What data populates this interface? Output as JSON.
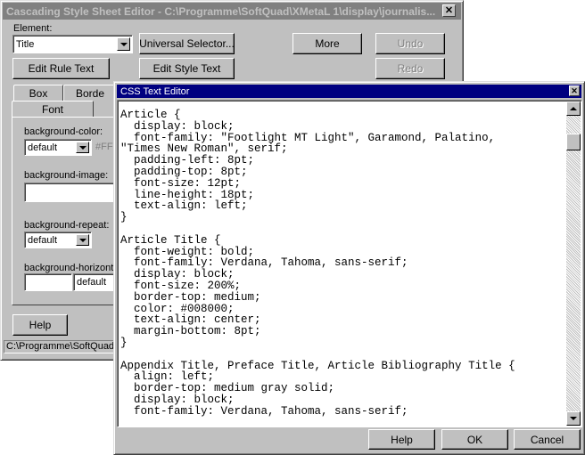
{
  "main_window": {
    "title": "Cascading Style Sheet Editor - C:\\Programme\\SoftQuad\\XMetaL 1\\display\\journalis...",
    "element_label": "Element:",
    "element_value": "Title",
    "buttons": {
      "universal_selector": "Universal Selector...",
      "more": "More",
      "undo": "Undo",
      "redo": "Redo",
      "edit_rule_text": "Edit Rule Text",
      "edit_style_text": "Edit Style Text",
      "help": "Help"
    },
    "tabs": [
      "Box",
      "Borde",
      "Font"
    ],
    "fields": {
      "background_color_label": "background-color:",
      "background_color_value": "default",
      "background_color_hex": "#FF",
      "background_image_label": "background-image:",
      "background_image_value": "",
      "background_repeat_label": "background-repeat:",
      "background_repeat_value": "default",
      "background_horizontal_label": "background-horizonta",
      "background_horizontal_value": "",
      "background_horizontal_unit": "default"
    },
    "status": "C:\\Programme\\SoftQuad\\"
  },
  "css_editor": {
    "title": "CSS Text Editor",
    "text": "Article {\n  display: block;\n  font-family: \"Footlight MT Light\", Garamond, Palatino,\n\"Times New Roman\", serif;\n  padding-left: 8pt;\n  padding-top: 8pt;\n  font-size: 12pt;\n  line-height: 18pt;\n  text-align: left;\n}\n\nArticle Title {\n  font-weight: bold;\n  font-family: Verdana, Tahoma, sans-serif;\n  display: block;\n  font-size: 200%;\n  border-top: medium;\n  color: #008000;\n  text-align: center;\n  margin-bottom: 8pt;\n}\n\nAppendix Title, Preface Title, Article Bibliography Title {\n  align: left;\n  border-top: medium gray solid;\n  display: block;\n  font-family: Verdana, Tahoma, sans-serif;",
    "buttons": {
      "help": "Help",
      "ok": "OK",
      "cancel": "Cancel"
    }
  },
  "colors": {
    "face": "#c0c0c0",
    "active_title": "#000080",
    "inactive_title": "#808080"
  }
}
